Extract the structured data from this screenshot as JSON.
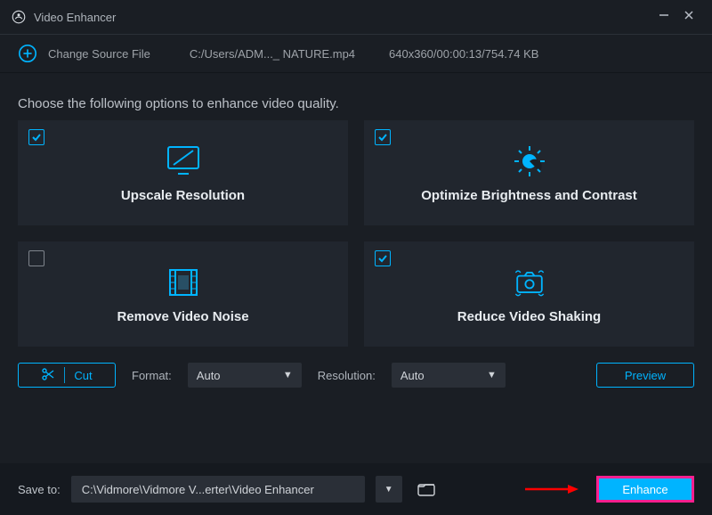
{
  "titlebar": {
    "title": "Video Enhancer"
  },
  "source": {
    "change_label": "Change Source File",
    "path": "C:/Users/ADM..._ NATURE.mp4",
    "meta": "640x360/00:00:13/754.74 KB"
  },
  "instructions": "Choose the following options to enhance video quality.",
  "cards": [
    {
      "label": "Upscale Resolution",
      "checked": true
    },
    {
      "label": "Optimize Brightness and Contrast",
      "checked": true
    },
    {
      "label": "Remove Video Noise",
      "checked": false
    },
    {
      "label": "Reduce Video Shaking",
      "checked": true
    }
  ],
  "controls": {
    "cut_label": "Cut",
    "format_label": "Format:",
    "format_value": "Auto",
    "resolution_label": "Resolution:",
    "resolution_value": "Auto",
    "preview_label": "Preview"
  },
  "footer": {
    "save_label": "Save to:",
    "path": "C:\\Vidmore\\Vidmore V...erter\\Video Enhancer",
    "enhance_label": "Enhance"
  }
}
